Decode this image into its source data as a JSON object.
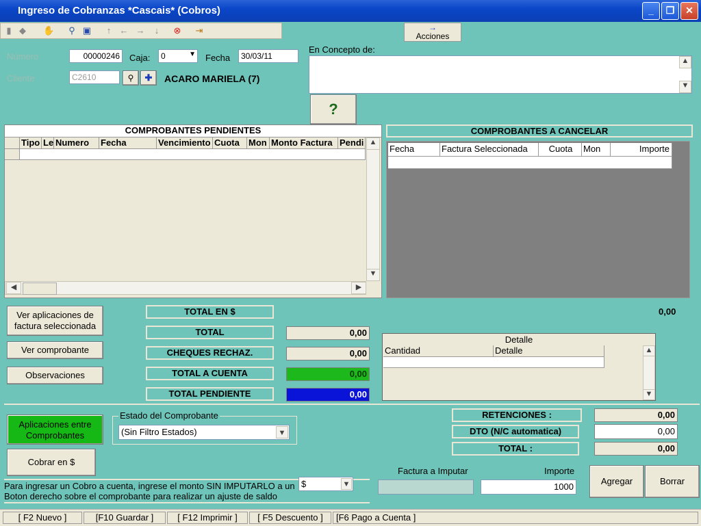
{
  "window": {
    "title": "Ingreso de Cobranzas *Cascais* (Cobros)"
  },
  "toolbar": {
    "acciones_arrow": "→",
    "acciones_label": "Acciones"
  },
  "form": {
    "numero_label": "Número",
    "numero_value": "00000246",
    "caja_label": "Caja:",
    "caja_value": "0",
    "fecha_label": "Fecha",
    "fecha_value": "30/03/11",
    "cliente_label": "Cliente",
    "cliente_code": "C2610",
    "cliente_name": "ACARO MARIELA (7)",
    "concepto_label": "En Concepto de:"
  },
  "pendientes": {
    "title": "COMPROBANTES PENDIENTES",
    "columns": [
      "Tipo",
      "Le",
      "Numero",
      "Fecha",
      "Vencimiento",
      "Cuota",
      "Mon",
      "Monto Factura",
      "Pendi"
    ]
  },
  "cancelar": {
    "title": "COMPROBANTES A CANCELAR",
    "columns": [
      "Fecha",
      "Factura Seleccionada",
      "Cuota",
      "Mon",
      "Importe"
    ],
    "total": "0,00"
  },
  "buttons": {
    "ver_aplicaciones": "Ver aplicaciones de factura seleccionada",
    "ver_comprobante": "Ver comprobante",
    "observaciones": "Observaciones",
    "aplicaciones_entre": "Aplicaciones entre Comprobantes",
    "cobrar": "Cobrar en $",
    "agregar": "Agregar",
    "borrar": "Borrar"
  },
  "totals": {
    "total_en_label": "TOTAL EN $",
    "total_label": "TOTAL",
    "total_value": "0,00",
    "cheques_label": "CHEQUES RECHAZ.",
    "cheques_value": "0,00",
    "cuenta_label": "TOTAL A CUENTA",
    "cuenta_value": "0,00",
    "pendiente_label": "TOTAL PENDIENTE",
    "pendiente_value": "0,00"
  },
  "detalle": {
    "title": "Detalle",
    "columns": [
      "Cantidad",
      "Detalle"
    ]
  },
  "estado": {
    "label": "Estado del Comprobante",
    "value": "(Sin Filtro Estados)"
  },
  "right_totals": {
    "retenciones_label": "RETENCIONES :",
    "retenciones_value": "0,00",
    "dto_label": "DTO (N/C automatica)",
    "dto_value": "0,00",
    "total_label": "TOTAL :",
    "total_value": "0,00"
  },
  "info": {
    "line1": "Para ingresar un Cobro a cuenta, ingrese el monto SIN IMPUTARLO a un",
    "line2": "Boton derecho sobre el comprobante para realizar un ajuste de saldo",
    "currency": "$"
  },
  "imputar": {
    "factura_label": "Factura a Imputar",
    "importe_label": "Importe",
    "importe_value": "1000"
  },
  "statusbar": [
    "[ F2 Nuevo ]",
    "[F10 Guardar ]",
    "[ F12 Imprimir ]",
    "[ F5 Descuento ]",
    "[F6 Pago a Cuenta ]"
  ],
  "colors": {
    "background": "#6ec4b8",
    "cuenta": "#1cb81c",
    "pendiente": "#0a14d8",
    "aplicaciones": "#16b816"
  }
}
